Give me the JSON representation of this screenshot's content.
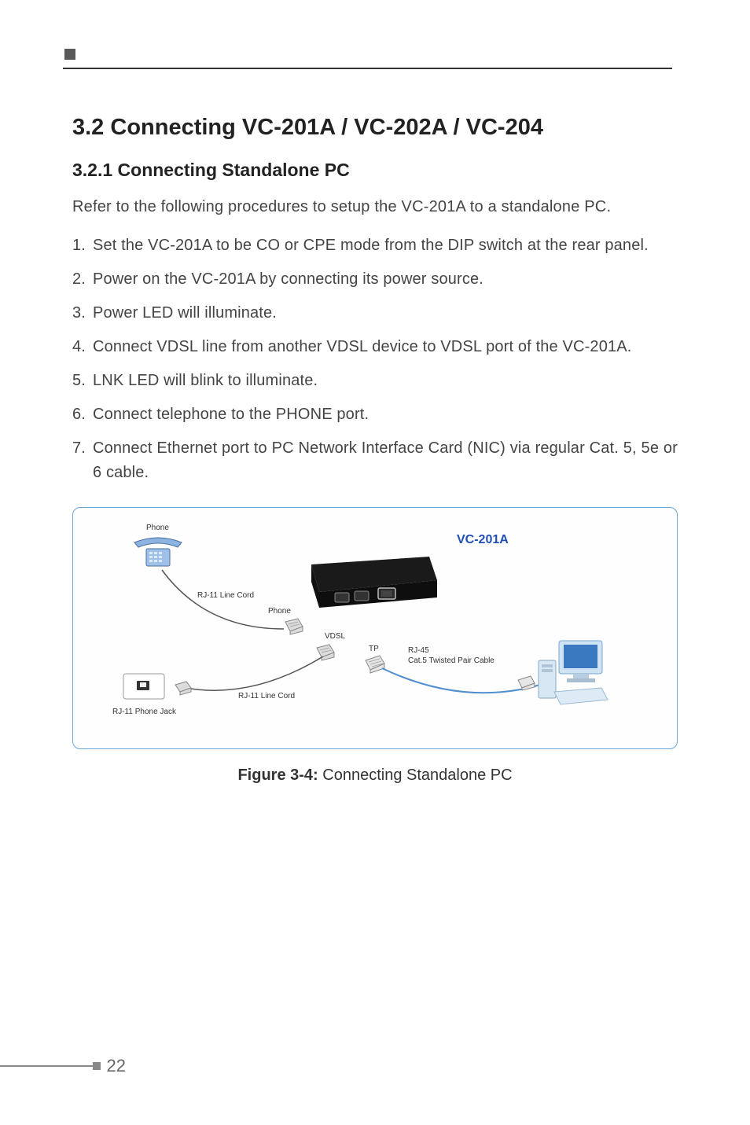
{
  "section": {
    "title": "3.2 Connecting VC-201A / VC-202A / VC-204",
    "subsection_title": "3.2.1  Connecting Standalone PC",
    "intro": "Refer to the following procedures to setup the VC-201A to a standalone PC.",
    "steps": [
      "Set the VC-201A to be CO or CPE mode from the DIP switch at the rear panel.",
      "Power on the VC-201A by connecting its power source.",
      "Power LED will illuminate.",
      "Connect VDSL line from another VDSL device to VDSL port of the VC-201A.",
      "LNK LED will blink to illuminate.",
      "Connect telephone to the PHONE port.",
      "Connect Ethernet port to PC Network Interface Card (NIC) via regular Cat. 5, 5e or 6 cable."
    ]
  },
  "figure": {
    "label_phone_top": "Phone",
    "label_rj11_cord_1": "RJ-11 Line Cord",
    "label_phone_port": "Phone",
    "label_vdsl": "VDSL",
    "label_tp": "TP",
    "label_rj45": "RJ-45",
    "label_cat5": "Cat.5 Twisted Pair Cable",
    "label_rj11_cord_2": "RJ-11 Line Cord",
    "label_rj11_jack": "RJ-11 Phone Jack",
    "product_name": "VC-201A",
    "caption_bold": "Figure 3-4:",
    "caption_rest": "  Connecting Standalone PC"
  },
  "page_number": "22"
}
